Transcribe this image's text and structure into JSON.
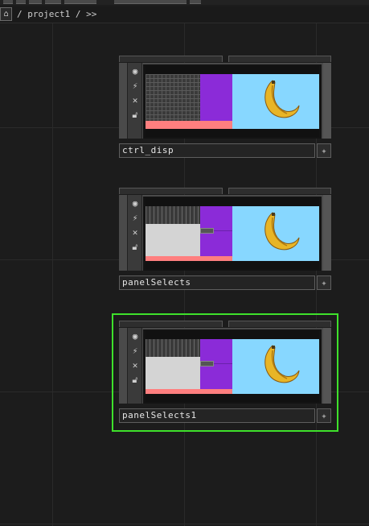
{
  "toolbar": {
    "home_icon": "home-icon",
    "path": "/ project1 / >>"
  },
  "nodes": [
    {
      "name": "ctrl_disp",
      "variant": "grid"
    },
    {
      "name": "panelSelects",
      "variant": "panel"
    },
    {
      "name": "panelSelects1",
      "variant": "panel",
      "selected": true
    }
  ],
  "sidebar_icons": [
    "viewer-icon",
    "bypass-icon",
    "close-icon",
    "lock-icon"
  ],
  "colors": {
    "background": "#1c1c1c",
    "selection": "#3ee12b",
    "purple": "#8b2bd8",
    "pink": "#ff7f7f",
    "cyan": "#87d7ff",
    "grey_panel": "#d4d4d4"
  }
}
